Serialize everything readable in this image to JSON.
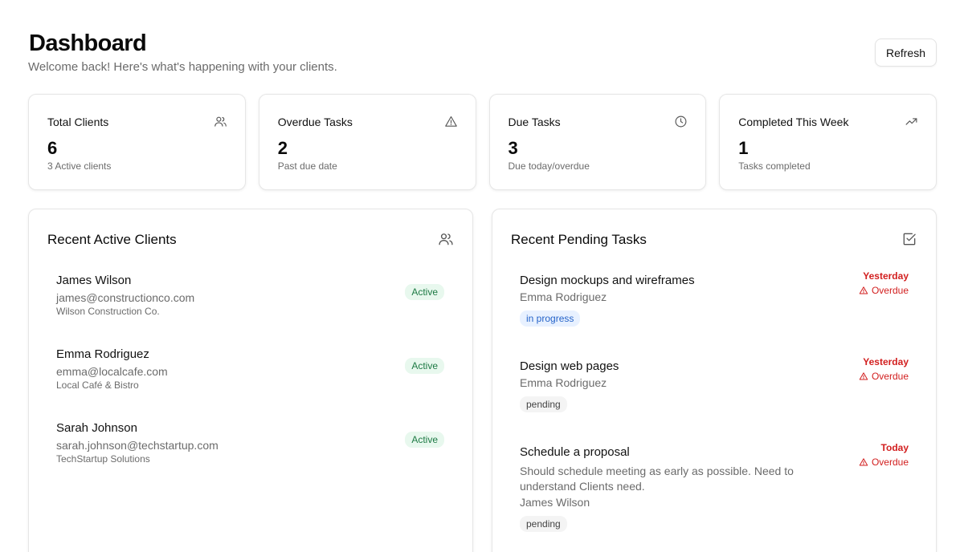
{
  "header": {
    "title": "Dashboard",
    "subtitle": "Welcome back! Here's what's happening with your clients.",
    "refresh_label": "Refresh"
  },
  "stats": [
    {
      "label": "Total Clients",
      "value": "6",
      "caption": "3 Active clients",
      "icon": "users-icon"
    },
    {
      "label": "Overdue Tasks",
      "value": "2",
      "caption": "Past due date",
      "icon": "alert-triangle-icon"
    },
    {
      "label": "Due Tasks",
      "value": "3",
      "caption": "Due today/overdue",
      "icon": "clock-icon"
    },
    {
      "label": "Completed This Week",
      "value": "1",
      "caption": "Tasks completed",
      "icon": "trending-up-icon"
    }
  ],
  "clients_panel": {
    "title": "Recent Active Clients",
    "icon": "users-icon",
    "clients": [
      {
        "name": "James Wilson",
        "email": "james@constructionco.com",
        "company": "Wilson Construction Co.",
        "status": "Active"
      },
      {
        "name": "Emma Rodriguez",
        "email": "emma@localcafe.com",
        "company": "Local Café & Bistro",
        "status": "Active"
      },
      {
        "name": "Sarah Johnson",
        "email": "sarah.johnson@techstartup.com",
        "company": "TechStartup Solutions",
        "status": "Active"
      }
    ]
  },
  "tasks_panel": {
    "title": "Recent Pending Tasks",
    "icon": "checkbox-icon",
    "tasks": [
      {
        "title": "Design mockups and wireframes",
        "description": "",
        "assignee": "Emma Rodriguez",
        "status": "in progress",
        "due": "Yesterday",
        "overdue": "Overdue"
      },
      {
        "title": "Design web pages",
        "description": "",
        "assignee": "Emma Rodriguez",
        "status": "pending",
        "due": "Yesterday",
        "overdue": "Overdue"
      },
      {
        "title": "Schedule a proposal",
        "description": "Should schedule meeting as early as possible. Need to understand Clients need.",
        "assignee": "James Wilson",
        "status": "pending",
        "due": "Today",
        "overdue": "Overdue"
      }
    ]
  },
  "colors": {
    "accent_red": "#d21f1f",
    "active_green": "#1d7a44",
    "progress_blue": "#2563c9"
  }
}
